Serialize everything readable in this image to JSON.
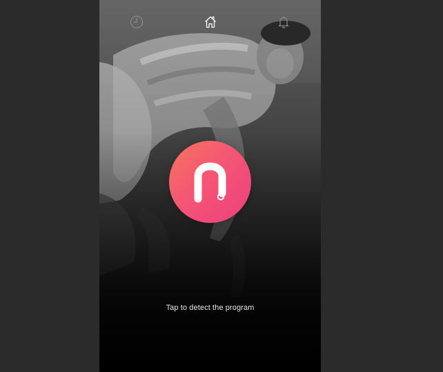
{
  "app": {
    "caption": "Tap to detect the program"
  },
  "nav": {
    "items": [
      {
        "icon": "clock-icon",
        "active": false
      },
      {
        "icon": "home-icon",
        "active": true
      },
      {
        "icon": "bell-icon",
        "active": false
      }
    ]
  },
  "logo": {
    "icon": "n-logo-icon",
    "gradient_start": "#f7755f",
    "gradient_end": "#ec3f7f"
  },
  "colors": {
    "page_bg": "#2b2b2b",
    "caption": "#e8e8e8",
    "icon_inactive": "#8a8a8a",
    "icon_active": "#ffffff"
  }
}
